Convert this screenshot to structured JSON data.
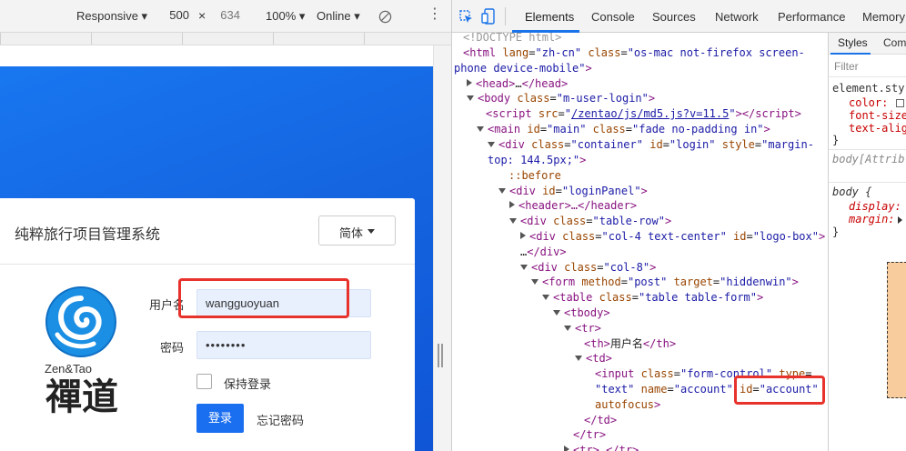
{
  "device_toolbar": {
    "mode": "Responsive",
    "width": "500",
    "times": "×",
    "height": "634",
    "zoom": "100%",
    "network": "Online"
  },
  "login": {
    "title": "纯粹旅行项目管理系统",
    "lang": "简体",
    "user_label": "用户名",
    "user_value": "wangguoyuan",
    "pass_label": "密码",
    "pass_value": "••••••••",
    "remember": "保持登录",
    "submit": "登录",
    "forgot": "忘记密码",
    "brand_en": "Zen&Tao",
    "brand_cn": "禪道"
  },
  "devtools": {
    "tabs": [
      "Elements",
      "Console",
      "Sources",
      "Network",
      "Performance",
      "Memory"
    ],
    "active_tab": "Elements",
    "styles_tabs": [
      "Styles",
      "Com"
    ],
    "filter_placeholder": "Filter"
  },
  "dom": {
    "doctype": "<!DOCTYPE html>",
    "html_attr_lang": "zh-cn",
    "html_class_1": "os-mac not-firefox screen-",
    "html_class_2": "phone device-mobile",
    "body_class": "m-user-login",
    "script_src": "/zentao/js/md5.js?v=11.5",
    "main_id": "main",
    "main_class": "fade no-padding in",
    "container_class": "container",
    "container_id": "login",
    "container_style_1": "margin-",
    "container_style_2": "top: 144.5px;",
    "before": "::before",
    "login_panel_id": "loginPanel",
    "header_text": "<header>…</header>",
    "table_row_class": "table-row",
    "col4_class": "col-4 text-center",
    "logo_box_id": "logo-box",
    "col8_class": "col-8",
    "form_method": "post",
    "form_target": "hiddenwin",
    "table_class": "table table-form",
    "th_text": "用户名",
    "input_class": "form-control",
    "input_type": "text",
    "input_name": "account",
    "input_id": "account",
    "autofocus": "autofocus"
  },
  "styles": {
    "rule1_selector": "element.sty",
    "rule1_p1": "color:",
    "rule1_p2": "font-size",
    "rule1_p3": "text-alig",
    "rule2_selector": "body[Attrib",
    "rule3_selector": "body {",
    "rule3_p1": "display:",
    "rule3_p2": "margin:"
  },
  "colors": {
    "accent_blue": "#1a6ef0",
    "highlight_red": "#e8322c",
    "devtools_tag": "#881280",
    "devtools_attr": "#994500",
    "devtools_value": "#1a1aa6"
  }
}
